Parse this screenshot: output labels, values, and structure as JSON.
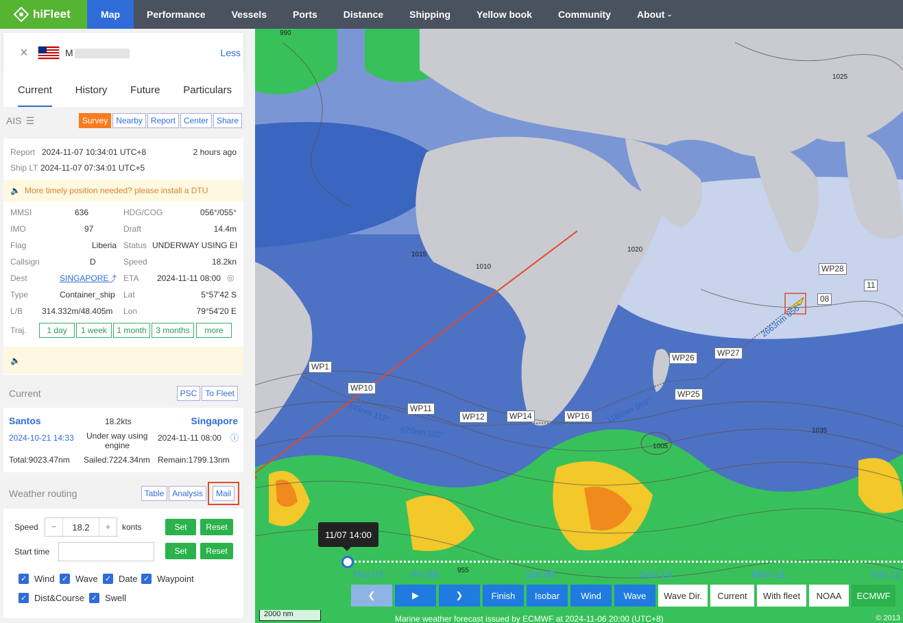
{
  "brand": {
    "name": "hiFleet"
  },
  "nav": {
    "items": [
      "Map",
      "Performance",
      "Vessels",
      "Ports",
      "Distance",
      "Shipping",
      "Yellow book",
      "Community",
      "About"
    ],
    "active": "Map"
  },
  "ship": {
    "name_prefix": "M",
    "less_label": "Less"
  },
  "tabs": [
    "Current",
    "History",
    "Future",
    "Particulars"
  ],
  "ais": {
    "label": "AIS",
    "buttons": [
      "Survey",
      "Nearby",
      "Report",
      "Center",
      "Share"
    ],
    "report_label": "Report",
    "report_time": "2024-11-07 10:34:01 UTC+8",
    "report_ago": "2 hours ago",
    "ship_lt_label": "Ship LT",
    "ship_lt": "2024-11-07 07:34:01 UTC+5",
    "dtu_notice": "More timely position needed? please install a DTU",
    "fields": {
      "mmsi_label": "MMSI",
      "mmsi": "636",
      "imo_label": "IMO",
      "imo": "97",
      "flag_label": "Flag",
      "flag": "Liberia",
      "callsign_label": "Callsign",
      "callsign": "D",
      "dest_label": "Dest",
      "dest": "SINGAPORE",
      "type_label": "Type",
      "type": "Container_ship",
      "lb_label": "L/B",
      "lb": "314.332m/48.405m",
      "hdg_label": "HDG/COG",
      "hdg": "056°/055°",
      "draft_label": "Draft",
      "draft": "14.4m",
      "status_label": "Status",
      "status": "UNDERWAY USING EI",
      "speed_label": "Speed",
      "speed": "18.2kn",
      "eta_label": "ETA",
      "eta": "2024-11-11 08:00",
      "lat_label": "Lat",
      "lat": "5°57'42 S",
      "lon_label": "Lon",
      "lon": "79°54'20 E"
    },
    "traj_label": "Traj.",
    "traj_buttons": [
      "1 day",
      "1 week",
      "1 month",
      "3 months",
      "more"
    ]
  },
  "current": {
    "title": "Current",
    "buttons": [
      "PSC",
      "To Fleet"
    ],
    "from_port": "Santos",
    "to_port": "Singapore",
    "speed": "18.2kts",
    "depart": "2024-10-21 14:33",
    "arrive": "2024-11-11 08:00",
    "status_line1": "Under way using",
    "status_line2": "engine",
    "total": "Total:9023.47nm",
    "sailed": "Sailed:7224.34nm",
    "remain": "Remain:1799.13nm"
  },
  "weather_routing": {
    "title": "Weather routing",
    "buttons": [
      "Table",
      "Analysis",
      "Mail"
    ],
    "speed_label": "Speed",
    "speed_value": "18.2",
    "speed_unit": "konts",
    "start_time_label": "Start time",
    "set_label": "Set",
    "reset_label": "Reset",
    "checkboxes": [
      "Wind",
      "Wave",
      "Date",
      "Waypoint",
      "Dist&Course",
      "Swell"
    ]
  },
  "map": {
    "waypoints": [
      "WP1",
      "WP10",
      "WP11",
      "WP12",
      "WP14",
      "WP16",
      "WP25",
      "WP26",
      "WP27",
      "WP28",
      "08",
      "11"
    ],
    "leg_labels": [
      "845nm 112°",
      "670nm 102°",
      "1180nm 069°",
      "2663nm 056°"
    ],
    "pressure_labels": [
      "990",
      "1015",
      "1010",
      "1005",
      "1020",
      "1025",
      "1035",
      "955"
    ],
    "time_tip": "11/07 14:00",
    "days": [
      "Thu 07",
      "Fri 08",
      "Sat 09",
      "Sun 10",
      "Mon 11",
      "Tue 12"
    ],
    "controls": [
      "Finish",
      "Isobar",
      "Wind",
      "Wave",
      "Wave Dir.",
      "Current",
      "With fleet",
      "NOAA",
      "ECMWF"
    ],
    "scale": "2000 nm",
    "footnote": "Marine weather forecast issued by ECMWF at 2024-11-06 20:00 (UTC+8)",
    "copyright": "© 2013"
  },
  "colors": {
    "brand_green": "#55b432",
    "nav_active": "#2f6cd8",
    "accent_orange": "#f57c1f",
    "highlight_red": "#e24a2a"
  }
}
